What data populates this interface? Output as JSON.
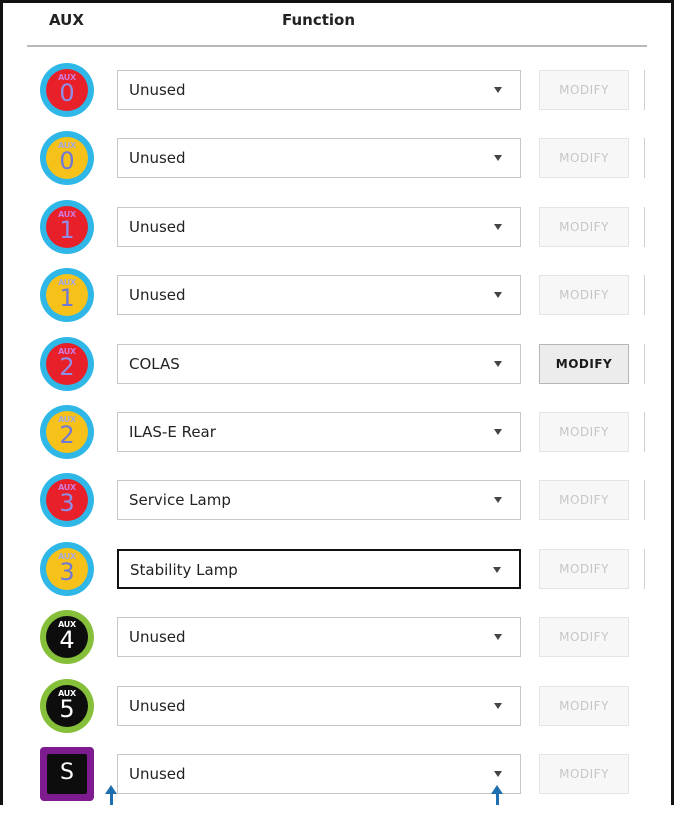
{
  "header": {
    "aux_label": "AUX",
    "function_label": "Function"
  },
  "colors": {
    "ring_blue": "#2fb7e8",
    "ring_green": "#86bf3a",
    "fill_red": "#e8202a",
    "fill_yellow": "#f6c21a",
    "fill_black": "#0d0d0d",
    "square_purple": "#7e1c8f",
    "pointer_blue": "#1f6fb0"
  },
  "rows": [
    {
      "aux_tag": "AUX",
      "number": "0",
      "style": "red",
      "ring": "blue",
      "function": "Unused",
      "modify_label": "MODIFY",
      "modify_enabled": false,
      "focused": false
    },
    {
      "aux_tag": "AUX",
      "number": "0",
      "style": "yellow",
      "ring": "blue",
      "function": "Unused",
      "modify_label": "MODIFY",
      "modify_enabled": false,
      "focused": false
    },
    {
      "aux_tag": "AUX",
      "number": "1",
      "style": "red",
      "ring": "blue",
      "function": "Unused",
      "modify_label": "MODIFY",
      "modify_enabled": false,
      "focused": false
    },
    {
      "aux_tag": "AUX",
      "number": "1",
      "style": "yellow",
      "ring": "blue",
      "function": "Unused",
      "modify_label": "MODIFY",
      "modify_enabled": false,
      "focused": false
    },
    {
      "aux_tag": "AUX",
      "number": "2",
      "style": "red",
      "ring": "blue",
      "function": "COLAS",
      "modify_label": "MODIFY",
      "modify_enabled": true,
      "focused": false
    },
    {
      "aux_tag": "AUX",
      "number": "2",
      "style": "yellow",
      "ring": "blue",
      "function": "ILAS-E Rear",
      "modify_label": "MODIFY",
      "modify_enabled": false,
      "focused": false
    },
    {
      "aux_tag": "AUX",
      "number": "3",
      "style": "red",
      "ring": "blue",
      "function": "Service Lamp",
      "modify_label": "MODIFY",
      "modify_enabled": false,
      "focused": false
    },
    {
      "aux_tag": "AUX",
      "number": "3",
      "style": "yellow",
      "ring": "blue",
      "function": "Stability Lamp",
      "modify_label": "MODIFY",
      "modify_enabled": false,
      "focused": true
    },
    {
      "aux_tag": "AUX",
      "number": "4",
      "style": "black",
      "ring": "green",
      "function": "Unused",
      "modify_label": "MODIFY",
      "modify_enabled": false,
      "focused": false
    },
    {
      "aux_tag": "AUX",
      "number": "5",
      "style": "black",
      "ring": "green",
      "function": "Unused",
      "modify_label": "MODIFY",
      "modify_enabled": false,
      "focused": false
    },
    {
      "aux_tag": "",
      "number": "S",
      "style": "square",
      "ring": "purple",
      "function": "Unused",
      "modify_label": "MODIFY",
      "modify_enabled": false,
      "focused": false
    }
  ]
}
